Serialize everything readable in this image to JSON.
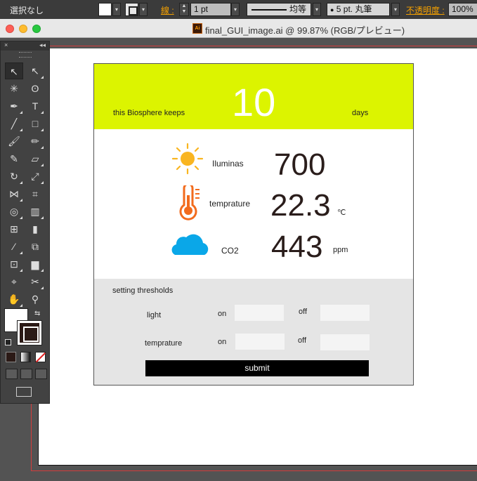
{
  "control_bar": {
    "selection": "選択なし",
    "stroke_label": "線 :",
    "stroke_weight": "1 pt",
    "stroke_profile": "均等",
    "brush": "5 pt. 丸筆",
    "opacity_label": "不透明度 :",
    "opacity": "100%"
  },
  "window": {
    "title": "final_GUI_image.ai @ 99.87% (RGB/プレビュー)",
    "doc_icon_text": "Ai"
  },
  "tools": {
    "panel_close": "×",
    "panel_collapse": "◂◂"
  },
  "design": {
    "header": {
      "lead": "this Biosphere keeps",
      "days_value": "10",
      "days_unit": "days"
    },
    "metrics": [
      {
        "label": "Iluminas",
        "value": "700",
        "unit": "",
        "icon": "sun-icon"
      },
      {
        "label": "temprature",
        "value": "22.3",
        "unit": "℃",
        "icon": "thermometer-icon"
      },
      {
        "label": "CO2",
        "value": "443",
        "unit": "ppm",
        "icon": "cloud-icon"
      }
    ],
    "thresholds": {
      "title": "setting thresholds",
      "rows": [
        {
          "label": "light",
          "on": "on",
          "off": "off"
        },
        {
          "label": "temprature",
          "on": "on",
          "off": "off"
        }
      ],
      "submit": "submit"
    },
    "colors": {
      "header": "#dcf400",
      "sun": "#f9b520",
      "thermo": "#f26b1d",
      "cloud": "#0aa7e8"
    }
  }
}
